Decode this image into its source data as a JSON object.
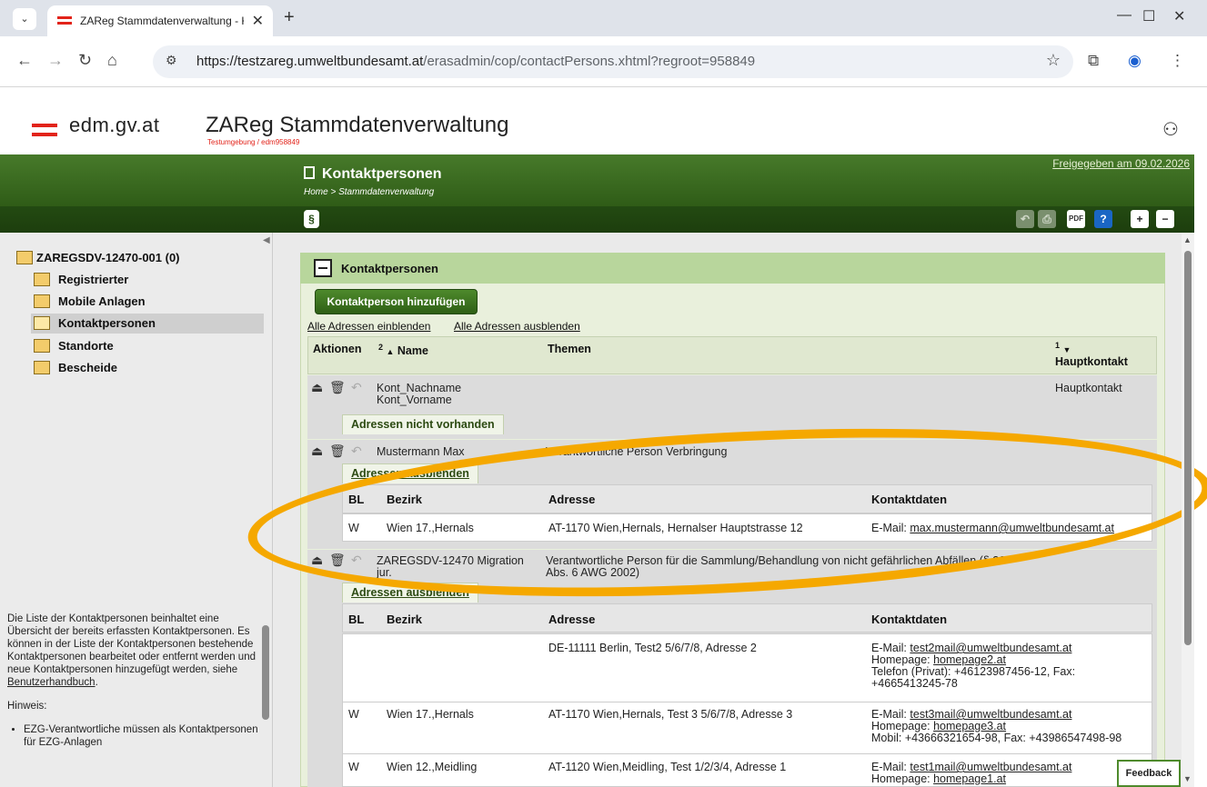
{
  "browser": {
    "tab_title": "ZAReg Stammdatenverwaltung - Kont",
    "url_host": "https://testzareg.umweltbundesamt.at",
    "url_path": "/erasadmin/cop/contactPersons.xhtml?regroot=958849",
    "icons": [
      "tab-menu-icon",
      "close-icon",
      "plus-icon",
      "back-icon",
      "forward-icon",
      "reload-icon",
      "home-icon",
      "site-settings-icon",
      "star-icon",
      "extensions-icon",
      "profile-icon",
      "menu-dots-icon"
    ]
  },
  "header": {
    "logo_text": "edm.gv.at",
    "app_title": "ZAReg Stammdatenverwaltung",
    "app_sub": "Testumgebung / edm958849"
  },
  "titlebar": {
    "title": "Kontaktpersonen",
    "breadcrumb": "Home > Stammdatenverwaltung",
    "released": "Freigegeben am 09.02.2026",
    "para_label": "§"
  },
  "sidebar": {
    "root": "ZAREGSDV-12470-001 (0)",
    "items": [
      {
        "label": "Registrierter"
      },
      {
        "label": "Mobile Anlagen"
      },
      {
        "label": "Kontaktpersonen"
      },
      {
        "label": "Standorte"
      },
      {
        "label": "Bescheide"
      }
    ],
    "help_text": "Die Liste der Kontaktpersonen beinhaltet eine Übersicht der bereits erfassten Kontaktpersonen. Es können in der Liste der Kontaktpersonen bestehende Kontaktpersonen bearbeitet oder entfernt werden und neue Kontaktpersonen hinzugefügt werden, siehe",
    "help_link": "Benutzerhandbuch",
    "help_end": ".",
    "hint_label": "Hinweis:",
    "hint_item": "EZG-Verantwortliche müssen als Kontaktpersonen für EZG-Anlagen"
  },
  "main": {
    "panel_title": "Kontaktpersonen",
    "add_button": "Kontaktperson hinzufügen",
    "show_all": "Alle Adressen einblenden",
    "hide_all": "Alle Adressen ausblenden",
    "columns": {
      "actions": "Aktionen",
      "name_sort": "2",
      "name": "Name",
      "topics": "Themen",
      "main_sort": "1",
      "main": "Hauptkontakt"
    },
    "rows": [
      {
        "name_line1": "Kont_Nachname",
        "name_line2": "Kont_Vorname",
        "topics": "",
        "main": "Hauptkontakt",
        "addr_toggle": "Adressen nicht vorhanden"
      },
      {
        "name_line1": "Mustermann Max",
        "topics": "Verantwortliche Person Verbringung",
        "addr_toggle": "Adressen ausblenden"
      },
      {
        "name_line1": "ZAREGSDV-12470 Migration",
        "name_line2": "jur.",
        "topics_line1": "Verantwortliche Person für die Sammlung/Behandlung von nicht gefährlichen Abfällen (§ 26",
        "topics_line2": "Abs. 6 AWG 2002)",
        "addr_toggle": "Adressen ausblenden"
      }
    ],
    "addr_columns": {
      "bl": "BL",
      "bezirk": "Bezirk",
      "adresse": "Adresse",
      "kontakt": "Kontaktdaten"
    },
    "addr_block1": [
      {
        "bl": "W",
        "bezirk": "Wien 17.,Hernals",
        "adresse": "AT-1170 Wien,Hernals, Hernalser Hauptstrasse 12",
        "email_label": "E-Mail:",
        "email": "max.mustermann@umweltbundesamt.at"
      }
    ],
    "addr_block2": [
      {
        "bl": "",
        "bezirk": "",
        "adresse": "DE-11111 Berlin, Test2 5/6/7/8, Adresse 2",
        "email_label": "E-Mail:",
        "email": "test2mail@umweltbundesamt.at",
        "home_label": "Homepage:",
        "home": "homepage2.at",
        "line3": "Telefon (Privat): +46123987456-12, Fax:",
        "line4": "+4665413245-78"
      },
      {
        "bl": "W",
        "bezirk": "Wien 17.,Hernals",
        "adresse": "AT-1170 Wien,Hernals, Test 3 5/6/7/8, Adresse 3",
        "email_label": "E-Mail:",
        "email": "test3mail@umweltbundesamt.at",
        "home_label": "Homepage:",
        "home": "homepage3.at",
        "line3": "Mobil: +43666321654-98, Fax: +43986547498-98"
      },
      {
        "bl": "W",
        "bezirk": "Wien 12.,Meidling",
        "adresse": "AT-1120 Wien,Meidling, Test 1/2/3/4, Adresse 1",
        "email_label": "E-Mail:",
        "email": "test1mail@umweltbundesamt.at",
        "home_label": "Homepage:",
        "home": "homepage1.at"
      }
    ],
    "feedback": "Feedback"
  },
  "colors": {
    "green_dark": "#2f5c17",
    "green_panel": "#b8d69c",
    "accent_red": "#e2231a",
    "highlight": "#f5a800"
  }
}
